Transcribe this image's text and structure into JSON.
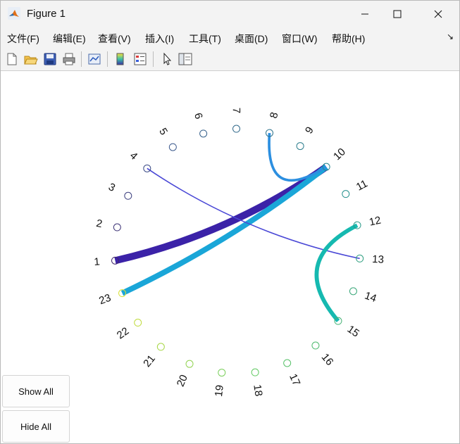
{
  "window": {
    "title": "Figure 1"
  },
  "menu": {
    "items": [
      "文件(F)",
      "编辑(E)",
      "查看(V)",
      "插入(I)",
      "工具(T)",
      "桌面(D)",
      "窗口(W)",
      "帮助(H)"
    ],
    "overflow_icon": "dock-arrow-icon"
  },
  "toolbar": {
    "icons": [
      "new-figure-icon",
      "open-file-icon",
      "save-icon",
      "print-icon",
      "link-plot-icon",
      "colorbar-icon",
      "legend-icon",
      "pointer-icon",
      "property-editor-icon"
    ]
  },
  "buttons": {
    "show_all": "Show All",
    "hide_all": "Hide All"
  },
  "colors": {
    "accent_titlebar": "#f3f3f3",
    "link_dark": "#3b22a8",
    "link_cyan": "#1aa6d8",
    "link_blue": "#4a48d6",
    "link_teal": "#16b9b0",
    "link_azure": "#2c8fe0"
  },
  "chart_data": {
    "type": "chord",
    "nodes": [
      "1",
      "2",
      "3",
      "4",
      "5",
      "6",
      "7",
      "8",
      "9",
      "10",
      "11",
      "12",
      "13",
      "14",
      "15",
      "16",
      "17",
      "18",
      "19",
      "20",
      "21",
      "22",
      "23"
    ],
    "links": [
      {
        "source": "1",
        "target": "10",
        "weight": 5
      },
      {
        "source": "23",
        "target": "10",
        "weight": 4
      },
      {
        "source": "4",
        "target": "13",
        "weight": 1
      },
      {
        "source": "12",
        "target": "15",
        "weight": 3
      },
      {
        "source": "8",
        "target": "10",
        "weight": 2
      }
    ]
  }
}
